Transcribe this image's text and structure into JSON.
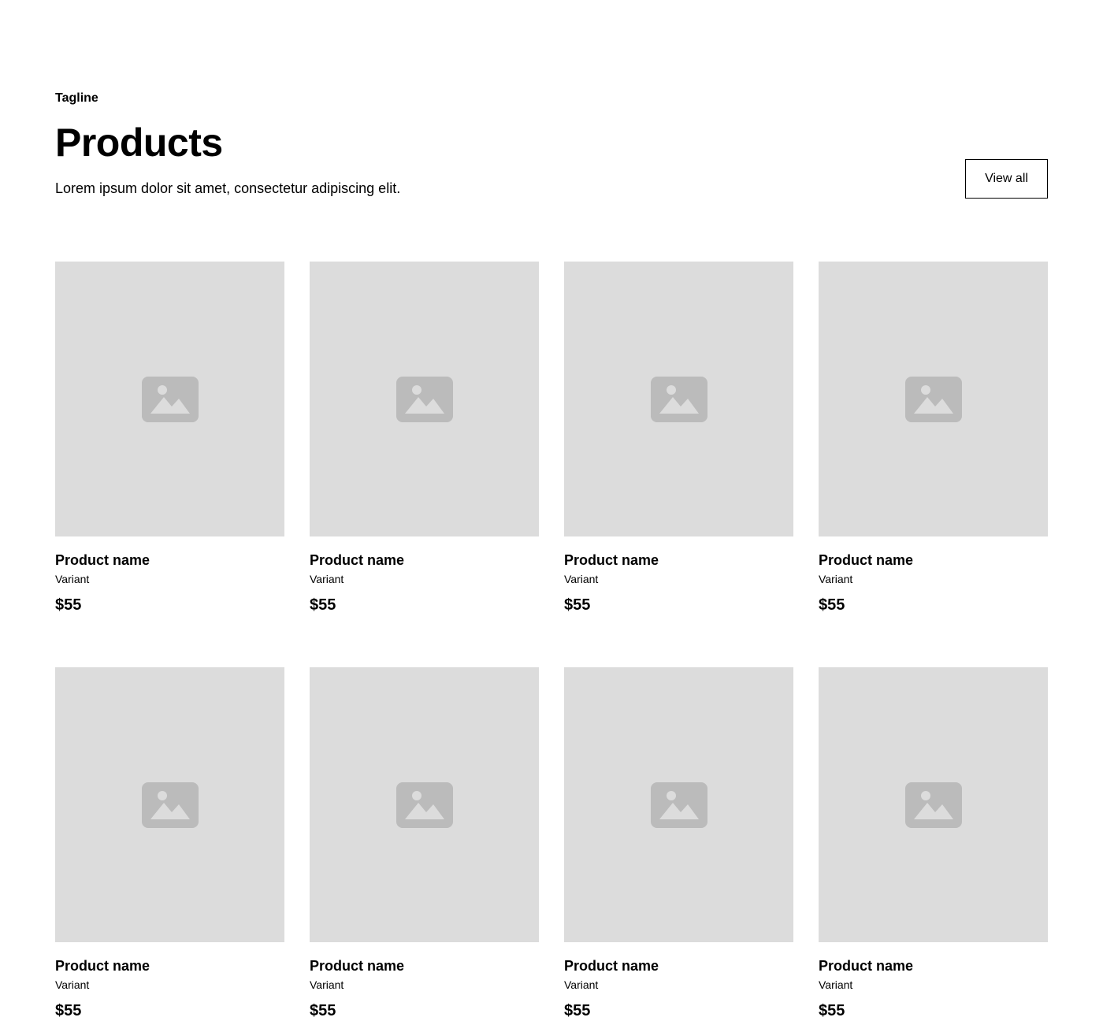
{
  "header": {
    "tagline": "Tagline",
    "title": "Products",
    "description": "Lorem ipsum dolor sit amet, consectetur adipiscing elit.",
    "view_all_label": "View all"
  },
  "products": [
    {
      "name": "Product name",
      "variant": "Variant",
      "price": "$55",
      "image_icon": "image-placeholder-icon"
    },
    {
      "name": "Product name",
      "variant": "Variant",
      "price": "$55",
      "image_icon": "image-placeholder-icon"
    },
    {
      "name": "Product name",
      "variant": "Variant",
      "price": "$55",
      "image_icon": "image-placeholder-icon"
    },
    {
      "name": "Product name",
      "variant": "Variant",
      "price": "$55",
      "image_icon": "image-placeholder-icon"
    },
    {
      "name": "Product name",
      "variant": "Variant",
      "price": "$55",
      "image_icon": "image-placeholder-icon"
    },
    {
      "name": "Product name",
      "variant": "Variant",
      "price": "$55",
      "image_icon": "image-placeholder-icon"
    },
    {
      "name": "Product name",
      "variant": "Variant",
      "price": "$55",
      "image_icon": "image-placeholder-icon"
    },
    {
      "name": "Product name",
      "variant": "Variant",
      "price": "$55",
      "image_icon": "image-placeholder-icon"
    }
  ],
  "colors": {
    "placeholder_bg": "#dcdcdc",
    "placeholder_icon": "#bbbbbb",
    "text": "#000000",
    "button_border": "#000000"
  }
}
